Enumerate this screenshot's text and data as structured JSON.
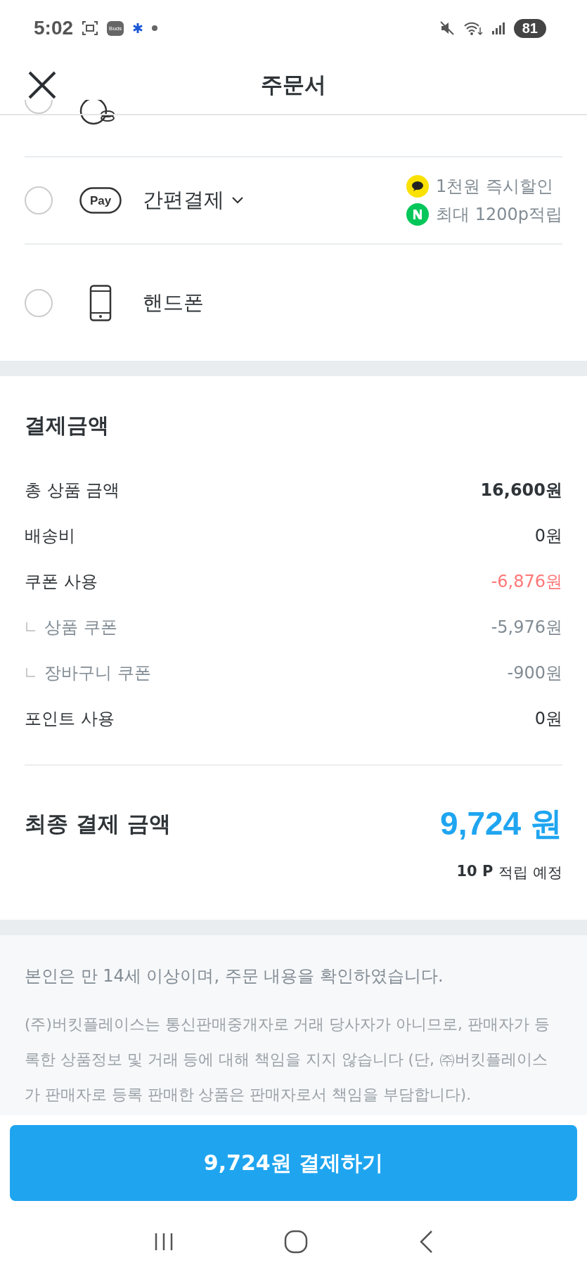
{
  "status_bar": {
    "time": "5:02",
    "buds_label": "Buds",
    "battery": "81"
  },
  "header": {
    "title": "주문서"
  },
  "payment_methods": [
    {
      "kind": "bank",
      "selected": false
    },
    {
      "kind": "pay",
      "icon_text": "Pay",
      "label": "간편결제",
      "selected": false,
      "benefits": [
        {
          "kind": "kakao",
          "text": "1천원 즉시할인"
        },
        {
          "kind": "naver",
          "text": "최대 1200p적립"
        }
      ]
    },
    {
      "kind": "phone",
      "label": "핸드폰",
      "selected": false
    }
  ],
  "summary": {
    "title": "결제금액",
    "rows": [
      {
        "label": "총 상품 금액",
        "value": "16,600원",
        "kind": "bold"
      },
      {
        "label": "배송비",
        "value": "0원",
        "kind": "normal"
      },
      {
        "label": "쿠폰 사용",
        "value": "-6,876원",
        "kind": "discount"
      },
      {
        "label": "상품 쿠폰",
        "value": "-5,976원",
        "kind": "sub"
      },
      {
        "label": "장바구니 쿠폰",
        "value": "-900원",
        "kind": "sub"
      },
      {
        "label": "포인트 사용",
        "value": "0원",
        "kind": "normal"
      }
    ],
    "final_label": "최종 결제 금액",
    "final_amount": "9,724 원",
    "points_value": "10 P",
    "points_label": "적립 예정"
  },
  "notice": {
    "agreement": "본인은 만 14세 이상이며, 주문 내용을 확인하였습니다.",
    "disclaimer": "(주)버킷플레이스는 통신판매중개자로 거래 당사자가 아니므로, 판매자가 등록한 상품정보 및 거래 등에 대해 책임을 지지 않습니다 (단, ㈜버킷플레이스가 판매자로 등록 판매한 상품은 판매자로서 책임을 부담합니다)."
  },
  "pay_button": "9,724원 결제하기"
}
